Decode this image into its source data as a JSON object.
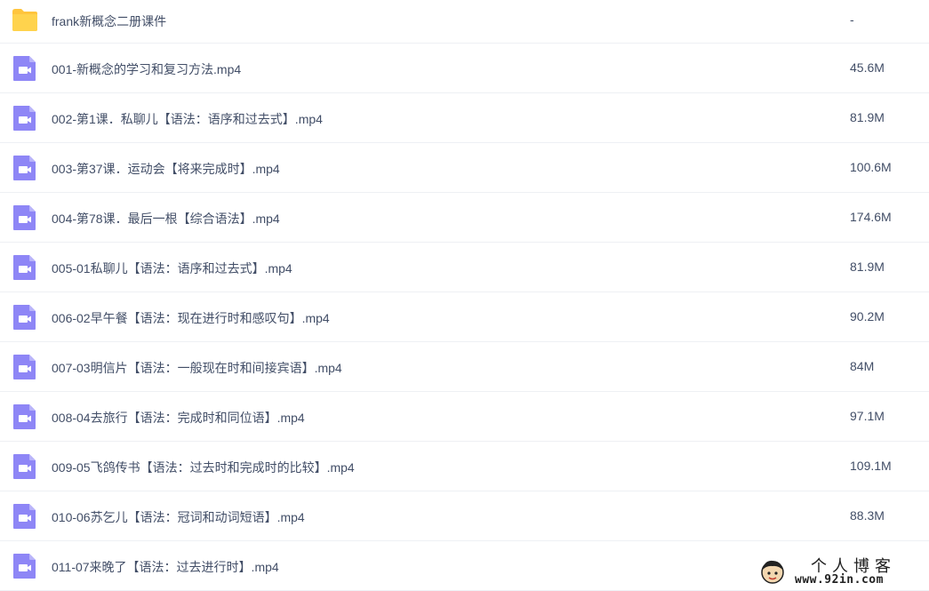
{
  "colors": {
    "folder": "#ffc53d",
    "video_icon": "#8e86f6",
    "text": "#424e67",
    "divider": "#eef0f4"
  },
  "files": [
    {
      "icon": "folder-icon",
      "name": "frank新概念二册课件",
      "size": "-"
    },
    {
      "icon": "video-file-icon",
      "name": "001-新概念的学习和复习方法.mp4",
      "size": "45.6M"
    },
    {
      "icon": "video-file-icon",
      "name": "002-第1课．私聊儿【语法：语序和过去式】.mp4",
      "size": "81.9M"
    },
    {
      "icon": "video-file-icon",
      "name": "003-第37课．运动会【将来完成时】.mp4",
      "size": "100.6M"
    },
    {
      "icon": "video-file-icon",
      "name": "004-第78课．最后一根【综合语法】.mp4",
      "size": "174.6M"
    },
    {
      "icon": "video-file-icon",
      "name": "005-01私聊儿【语法：语序和过去式】.mp4",
      "size": "81.9M"
    },
    {
      "icon": "video-file-icon",
      "name": "006-02早午餐【语法：现在进行时和感叹句】.mp4",
      "size": "90.2M"
    },
    {
      "icon": "video-file-icon",
      "name": "007-03明信片【语法：一般现在时和间接宾语】.mp4",
      "size": "84M"
    },
    {
      "icon": "video-file-icon",
      "name": "008-04去旅行【语法：完成时和同位语】.mp4",
      "size": "97.1M"
    },
    {
      "icon": "video-file-icon",
      "name": "009-05飞鸽传书【语法：过去时和完成时的比较】.mp4",
      "size": "109.1M"
    },
    {
      "icon": "video-file-icon",
      "name": "010-06苏乞儿【语法：冠词和动词短语】.mp4",
      "size": "88.3M"
    },
    {
      "icon": "video-file-icon",
      "name": "011-07来晚了【语法：过去进行时】.mp4",
      "size": ""
    }
  ],
  "watermark": {
    "title": "个人博客",
    "url": "www.92in.com"
  }
}
